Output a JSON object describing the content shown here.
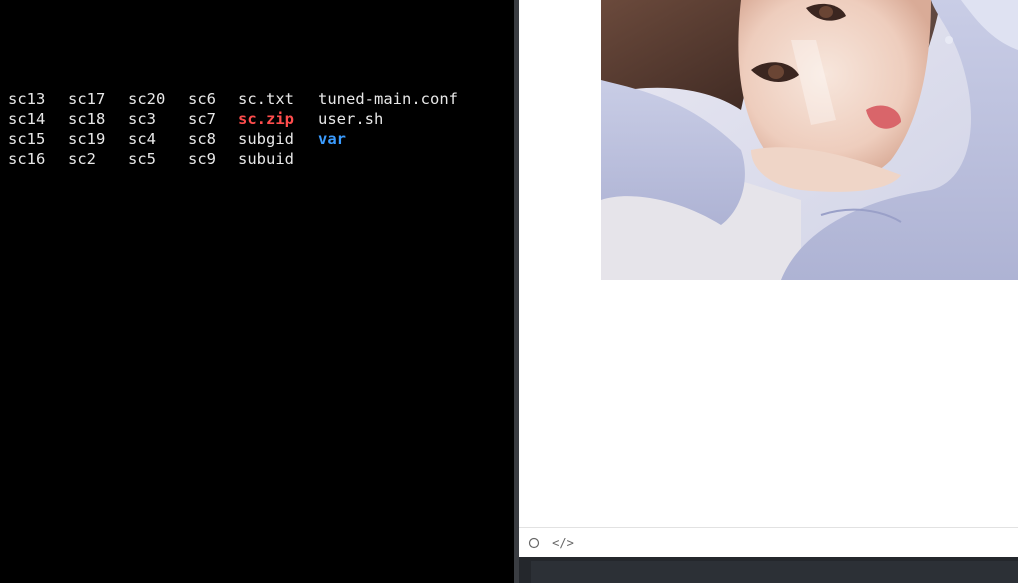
{
  "terminal": {
    "rows": [
      [
        {
          "text": "sc13",
          "kind": "file"
        },
        {
          "text": "sc17",
          "kind": "file"
        },
        {
          "text": "sc20",
          "kind": "file"
        },
        {
          "text": "sc6",
          "kind": "file"
        },
        {
          "text": "sc.txt",
          "kind": "file"
        },
        {
          "text": "tuned-main.conf",
          "kind": "file"
        }
      ],
      [
        {
          "text": "sc14",
          "kind": "file"
        },
        {
          "text": "sc18",
          "kind": "file"
        },
        {
          "text": "sc3",
          "kind": "file"
        },
        {
          "text": "sc7",
          "kind": "file"
        },
        {
          "text": "sc.zip",
          "kind": "archive"
        },
        {
          "text": "user.sh",
          "kind": "file"
        }
      ],
      [
        {
          "text": "sc15",
          "kind": "file"
        },
        {
          "text": "sc19",
          "kind": "file"
        },
        {
          "text": "sc4",
          "kind": "file"
        },
        {
          "text": "sc8",
          "kind": "file"
        },
        {
          "text": "subgid",
          "kind": "file"
        },
        {
          "text": "var",
          "kind": "dir"
        }
      ],
      [
        {
          "text": "sc16",
          "kind": "file"
        },
        {
          "text": "sc2",
          "kind": "file"
        },
        {
          "text": "sc5",
          "kind": "file"
        },
        {
          "text": "sc9",
          "kind": "file"
        },
        {
          "text": "subuid",
          "kind": "file"
        },
        {
          "text": "",
          "kind": "file"
        }
      ]
    ],
    "colors": {
      "background": "#000000",
      "file": "#e8e8e8",
      "archive": "#ff4d4d",
      "dir": "#3b9cff"
    }
  },
  "preview": {
    "image_icon": "portrait-photo",
    "footer": {
      "circle_icon": "circle-icon",
      "code_icon": "code-icon",
      "code_glyph": "</>"
    }
  }
}
